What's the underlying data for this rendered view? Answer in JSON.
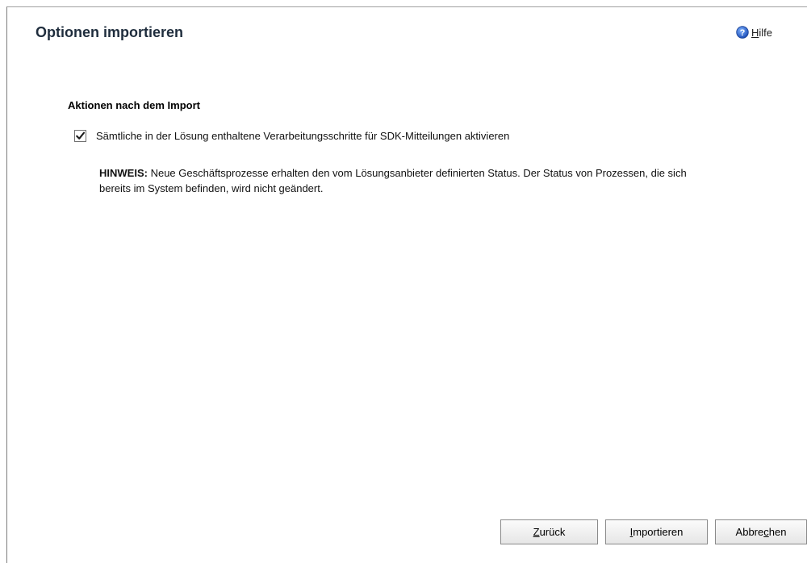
{
  "dialog": {
    "title": "Optionen importieren"
  },
  "help": {
    "label_ul": "H",
    "label_rest": "ilfe"
  },
  "section": {
    "title": "Aktionen nach dem Import"
  },
  "option": {
    "checked": true,
    "label": "Sämtliche in der Lösung enthaltene Verarbeitungsschritte für SDK-Mitteilungen aktivieren"
  },
  "note": {
    "label": "HINWEIS:",
    "text": "Neue Geschäftsprozesse erhalten den vom Lösungsanbieter definierten Status. Der Status von Prozessen, die sich bereits im System befinden, wird nicht geändert."
  },
  "buttons": {
    "back": {
      "ul": "Z",
      "rest": "urück"
    },
    "import": {
      "ul": "I",
      "rest": "mportieren"
    },
    "cancel": {
      "pre": "Abbre",
      "ul": "c",
      "rest": "hen"
    }
  },
  "colors": {
    "title": "#1f2d3d",
    "help_icon": "#2a62c9"
  }
}
